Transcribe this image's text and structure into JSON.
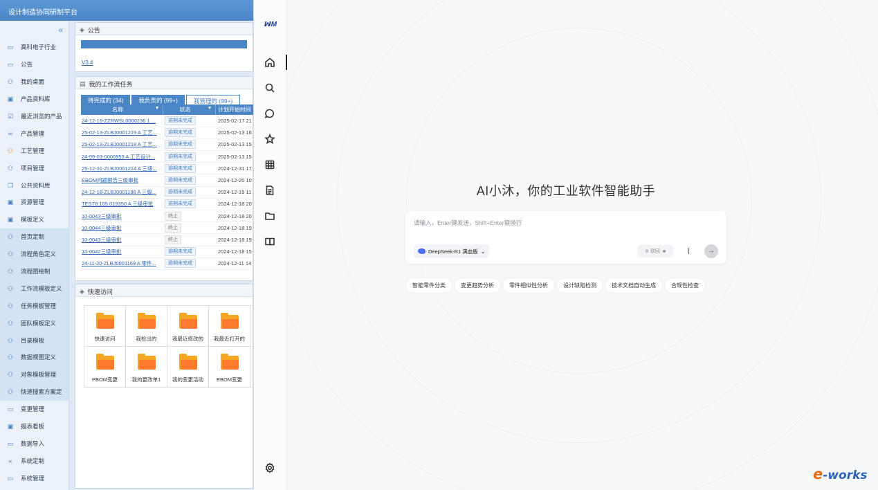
{
  "platform": {
    "title": "设计制造协同研制平台",
    "sidebar_collapse_icon": "«",
    "sidebar": [
      {
        "label": "高科电子行业",
        "icon": "monitor-icon"
      },
      {
        "label": "公告",
        "icon": "monitor-icon"
      },
      {
        "label": "我的桌面",
        "icon": "users-icon"
      },
      {
        "label": "产品资料库",
        "icon": "book-icon"
      },
      {
        "label": "最近浏览的产品",
        "icon": "check-box-icon"
      },
      {
        "label": "产品管理",
        "icon": "glasses-icon"
      },
      {
        "label": "工艺管理",
        "icon": "users-icon"
      },
      {
        "label": "项目管理",
        "icon": "users-icon"
      },
      {
        "label": "公共资料库",
        "icon": "copy-icon"
      },
      {
        "label": "资源管理",
        "icon": "book-icon"
      },
      {
        "label": "模板定义",
        "icon": "book-icon"
      },
      {
        "label": "首页定制",
        "icon": "users-icon"
      },
      {
        "label": "流程角色定义",
        "icon": "users-icon"
      },
      {
        "label": "流程图绘制",
        "icon": "users-icon"
      },
      {
        "label": "工作流模板定义",
        "icon": "users-icon"
      },
      {
        "label": "任务模板管理",
        "icon": "users-icon"
      },
      {
        "label": "团队模板定义",
        "icon": "users-icon"
      },
      {
        "label": "目录模板",
        "icon": "users-icon"
      },
      {
        "label": "数据视图定义",
        "icon": "users-icon"
      },
      {
        "label": "对象模板管理",
        "icon": "users-icon"
      },
      {
        "label": "快速搜索方案定",
        "icon": "users-icon"
      },
      {
        "label": "变更管理",
        "icon": "monitor-icon"
      },
      {
        "label": "报表看板",
        "icon": "book-icon"
      },
      {
        "label": "数据导入",
        "icon": "monitor-icon"
      },
      {
        "label": "系统定制",
        "icon": "double-chevron-icon"
      },
      {
        "label": "系统管理",
        "icon": "monitor-icon"
      }
    ],
    "notice": {
      "title": "公告",
      "link": "V3.4"
    },
    "workflow": {
      "title": "我的工作流任务",
      "tabs": [
        "待完成的 (34)",
        "我负责的 (99+)",
        "我管理的 (99+)"
      ],
      "columns": [
        "名称",
        "状态",
        "计划开始时间"
      ],
      "rows": [
        {
          "name": "24-12-19-ZZRWSL0000236 1 ...",
          "status": "逾期未完成",
          "date": "2025-02-17 21"
        },
        {
          "name": "25-02-13-ZLBJ0001219 A 工艺...",
          "status": "逾期未完成",
          "date": "2025-02-13 16"
        },
        {
          "name": "25-02-13-ZLBJ0001218 A 工艺...",
          "status": "逾期未完成",
          "date": "2025-02-13 15"
        },
        {
          "name": "24-09-03-0000953 A 工艺设计...",
          "status": "逾期未完成",
          "date": "2025-02-13 15"
        },
        {
          "name": "25-12-31-ZLBJ0001214 A 三级...",
          "status": "逾期未完成",
          "date": "2024-12-31 17"
        },
        {
          "name": "EBOM问题报告三级审批",
          "status": "逾期未完成",
          "date": "2024-12-20 10"
        },
        {
          "name": "24-12-18-ZLBJ0001198 A 三级...",
          "status": "逾期未完成",
          "date": "2024-12-19 11"
        },
        {
          "name": "TEST8.105.019350 A 三级审批",
          "status": "逾期未完成",
          "date": "2024-12-18 20"
        },
        {
          "name": "10-0043三级审批",
          "status": "终止",
          "date": "2024-12-18 20"
        },
        {
          "name": "10-0044三级审批",
          "status": "终止",
          "date": "2024-12-18 19"
        },
        {
          "name": "10-0043三级审批",
          "status": "终止",
          "date": "2024-12-18 19"
        },
        {
          "name": "10-0042三级审批",
          "status": "逾期未完成",
          "date": "2024-12-18 15"
        },
        {
          "name": "24-11-20-ZLBJ0001169 A 零件...",
          "status": "逾期未完成",
          "date": "2024-12-11 14"
        }
      ]
    },
    "quick_access": {
      "title": "快速访问",
      "items": [
        "快速访问",
        "我检出的",
        "我最近修改的",
        "我最近打开的",
        "PBOM变更",
        "我的更改单1",
        "我的变更活动",
        "EBOM变更"
      ]
    }
  },
  "ai": {
    "logo": "ꟽM",
    "greeting": "AI小沐，你的工业软件智能助手",
    "input_placeholder": "请输入，Enter键发送，Shift+Enter键换行",
    "model": "DeepSeek-R1 满血版",
    "web_toggle": "联网",
    "chips": [
      "智能零件分类",
      "变更趋势分析",
      "零件相似性分析",
      "设计缺陷检测",
      "技术文档自动生成",
      "合规性检查"
    ],
    "rail_icons": [
      "home-icon",
      "search-icon",
      "chat-icon",
      "star-icon",
      "grid-icon",
      "document-icon",
      "folder-icon",
      "book-icon",
      "settings-icon"
    ]
  },
  "watermark": {
    "e": "e",
    "rest": "-works"
  }
}
